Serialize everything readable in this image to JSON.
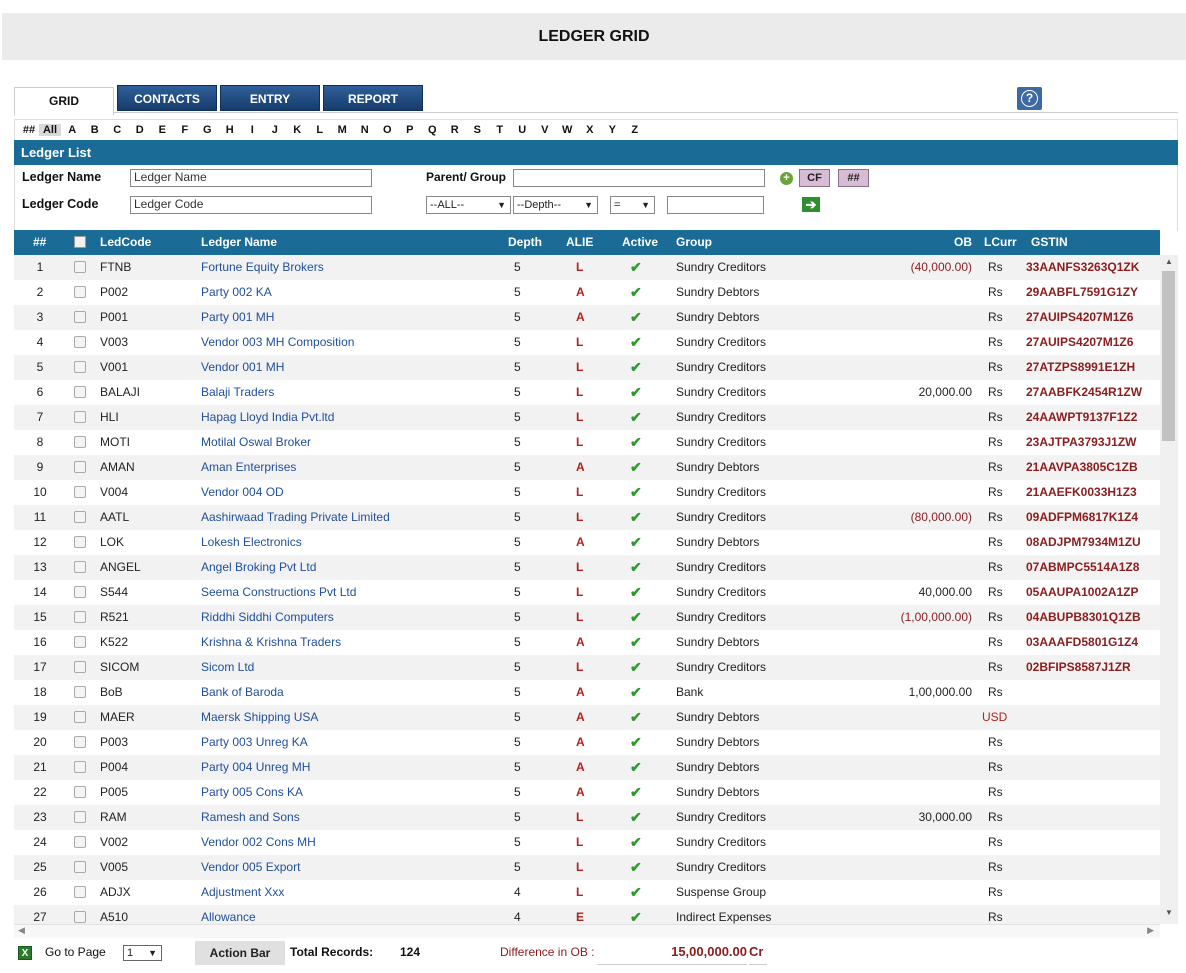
{
  "title": "LEDGER GRID",
  "tabs": [
    "GRID",
    "CONTACTS",
    "ENTRY",
    "REPORT"
  ],
  "alphabet": [
    "##",
    "All",
    "A",
    "B",
    "C",
    "D",
    "E",
    "F",
    "G",
    "H",
    "I",
    "J",
    "K",
    "L",
    "M",
    "N",
    "O",
    "P",
    "Q",
    "R",
    "S",
    "T",
    "U",
    "V",
    "W",
    "X",
    "Y",
    "Z"
  ],
  "selected_letter": "All",
  "list_title": "Ledger List",
  "filters": {
    "ledger_name_label": "Ledger Name",
    "ledger_name_value": "Ledger Name",
    "ledger_code_label": "Ledger Code",
    "ledger_code_value": "Ledger Code",
    "parent_group_label": "Parent/ Group",
    "parent_group_value": "",
    "type_select": "--ALL--",
    "depth_select": "--Depth--",
    "op_select": "=",
    "depth_value": "",
    "cf_label": "CF",
    "hash_label": "##"
  },
  "columns": {
    "num": "##",
    "code": "LedCode",
    "name": "Ledger Name",
    "depth": "Depth",
    "alie": "ALIE",
    "active": "Active",
    "group": "Group",
    "ob": "OB",
    "lcurr": "LCurr",
    "gstin": "GSTIN"
  },
  "rows": [
    {
      "n": "1",
      "code": "FTNB",
      "name": "Fortune Equity Brokers",
      "depth": "5",
      "alie": "L",
      "group": "Sundry Creditors",
      "ob": "(40,000.00)",
      "neg": true,
      "cur": "Rs",
      "gstin": "33AANFS3263Q1ZK"
    },
    {
      "n": "2",
      "code": "P002",
      "name": "Party 002 KA",
      "depth": "5",
      "alie": "A",
      "group": "Sundry Debtors",
      "ob": "",
      "neg": false,
      "cur": "Rs",
      "gstin": "29AABFL7591G1ZY"
    },
    {
      "n": "3",
      "code": "P001",
      "name": "Party 001 MH",
      "depth": "5",
      "alie": "A",
      "group": "Sundry Debtors",
      "ob": "",
      "neg": false,
      "cur": "Rs",
      "gstin": "27AUIPS4207M1Z6"
    },
    {
      "n": "4",
      "code": "V003",
      "name": "Vendor 003 MH Composition",
      "depth": "5",
      "alie": "L",
      "group": "Sundry Creditors",
      "ob": "",
      "neg": false,
      "cur": "Rs",
      "gstin": "27AUIPS4207M1Z6"
    },
    {
      "n": "5",
      "code": "V001",
      "name": "Vendor 001 MH",
      "depth": "5",
      "alie": "L",
      "group": "Sundry Creditors",
      "ob": "",
      "neg": false,
      "cur": "Rs",
      "gstin": "27ATZPS8991E1ZH"
    },
    {
      "n": "6",
      "code": "BALAJI",
      "name": "Balaji Traders",
      "depth": "5",
      "alie": "L",
      "group": "Sundry Creditors",
      "ob": "20,000.00",
      "neg": false,
      "cur": "Rs",
      "gstin": "27AABFK2454R1ZW"
    },
    {
      "n": "7",
      "code": "HLI",
      "name": "Hapag Lloyd India Pvt.ltd",
      "depth": "5",
      "alie": "L",
      "group": "Sundry Creditors",
      "ob": "",
      "neg": false,
      "cur": "Rs",
      "gstin": "24AAWPT9137F1Z2"
    },
    {
      "n": "8",
      "code": "MOTI",
      "name": "Motilal Oswal Broker",
      "depth": "5",
      "alie": "L",
      "group": "Sundry Creditors",
      "ob": "",
      "neg": false,
      "cur": "Rs",
      "gstin": "23AJTPA3793J1ZW"
    },
    {
      "n": "9",
      "code": "AMAN",
      "name": "Aman Enterprises",
      "depth": "5",
      "alie": "A",
      "group": "Sundry Debtors",
      "ob": "",
      "neg": false,
      "cur": "Rs",
      "gstin": "21AAVPA3805C1ZB"
    },
    {
      "n": "10",
      "code": "V004",
      "name": "Vendor 004 OD",
      "depth": "5",
      "alie": "L",
      "group": "Sundry Creditors",
      "ob": "",
      "neg": false,
      "cur": "Rs",
      "gstin": "21AAEFK0033H1Z3"
    },
    {
      "n": "11",
      "code": "AATL",
      "name": "Aashirwaad Trading Private Limited",
      "depth": "5",
      "alie": "L",
      "group": "Sundry Creditors",
      "ob": "(80,000.00)",
      "neg": true,
      "cur": "Rs",
      "gstin": "09ADFPM6817K1Z4"
    },
    {
      "n": "12",
      "code": "LOK",
      "name": "Lokesh Electronics",
      "depth": "5",
      "alie": "A",
      "group": "Sundry Debtors",
      "ob": "",
      "neg": false,
      "cur": "Rs",
      "gstin": "08ADJPM7934M1ZU"
    },
    {
      "n": "13",
      "code": "ANGEL",
      "name": "Angel Broking Pvt Ltd",
      "depth": "5",
      "alie": "L",
      "group": "Sundry Creditors",
      "ob": "",
      "neg": false,
      "cur": "Rs",
      "gstin": "07ABMPC5514A1Z8"
    },
    {
      "n": "14",
      "code": "S544",
      "name": "Seema Constructions Pvt Ltd",
      "depth": "5",
      "alie": "L",
      "group": "Sundry Creditors",
      "ob": "40,000.00",
      "neg": false,
      "cur": "Rs",
      "gstin": "05AAUPA1002A1ZP"
    },
    {
      "n": "15",
      "code": "R521",
      "name": "Riddhi Siddhi Computers",
      "depth": "5",
      "alie": "L",
      "group": "Sundry Creditors",
      "ob": "(1,00,000.00)",
      "neg": true,
      "cur": "Rs",
      "gstin": "04ABUPB8301Q1ZB"
    },
    {
      "n": "16",
      "code": "K522",
      "name": "Krishna & Krishna Traders",
      "depth": "5",
      "alie": "A",
      "group": "Sundry Debtors",
      "ob": "",
      "neg": false,
      "cur": "Rs",
      "gstin": "03AAAFD5801G1Z4"
    },
    {
      "n": "17",
      "code": "SICOM",
      "name": "Sicom Ltd",
      "depth": "5",
      "alie": "L",
      "group": "Sundry Creditors",
      "ob": "",
      "neg": false,
      "cur": "Rs",
      "gstin": "02BFIPS8587J1ZR"
    },
    {
      "n": "18",
      "code": "BoB",
      "name": "Bank of Baroda",
      "depth": "5",
      "alie": "A",
      "group": "Bank",
      "ob": "1,00,000.00",
      "neg": false,
      "cur": "Rs",
      "gstin": ""
    },
    {
      "n": "19",
      "code": "MAER",
      "name": "Maersk Shipping USA",
      "depth": "5",
      "alie": "A",
      "group": "Sundry Debtors",
      "ob": "",
      "neg": false,
      "cur": "USD",
      "gstin": ""
    },
    {
      "n": "20",
      "code": "P003",
      "name": "Party 003 Unreg KA",
      "depth": "5",
      "alie": "A",
      "group": "Sundry Debtors",
      "ob": "",
      "neg": false,
      "cur": "Rs",
      "gstin": ""
    },
    {
      "n": "21",
      "code": "P004",
      "name": "Party 004 Unreg MH",
      "depth": "5",
      "alie": "A",
      "group": "Sundry Debtors",
      "ob": "",
      "neg": false,
      "cur": "Rs",
      "gstin": ""
    },
    {
      "n": "22",
      "code": "P005",
      "name": "Party 005 Cons KA",
      "depth": "5",
      "alie": "A",
      "group": "Sundry Debtors",
      "ob": "",
      "neg": false,
      "cur": "Rs",
      "gstin": ""
    },
    {
      "n": "23",
      "code": "RAM",
      "name": "Ramesh and Sons",
      "depth": "5",
      "alie": "L",
      "group": "Sundry Creditors",
      "ob": "30,000.00",
      "neg": false,
      "cur": "Rs",
      "gstin": ""
    },
    {
      "n": "24",
      "code": "V002",
      "name": "Vendor 002 Cons MH",
      "depth": "5",
      "alie": "L",
      "group": "Sundry Creditors",
      "ob": "",
      "neg": false,
      "cur": "Rs",
      "gstin": ""
    },
    {
      "n": "25",
      "code": "V005",
      "name": "Vendor 005 Export",
      "depth": "5",
      "alie": "L",
      "group": "Sundry Creditors",
      "ob": "",
      "neg": false,
      "cur": "Rs",
      "gstin": ""
    },
    {
      "n": "26",
      "code": "ADJX",
      "name": "Adjustment Xxx",
      "depth": "4",
      "alie": "L",
      "group": "Suspense Group",
      "ob": "",
      "neg": false,
      "cur": "Rs",
      "gstin": ""
    },
    {
      "n": "27",
      "code": "A510",
      "name": "Allowance",
      "depth": "4",
      "alie": "E",
      "group": "Indirect Expenses",
      "ob": "",
      "neg": false,
      "cur": "Rs",
      "gstin": ""
    }
  ],
  "footer": {
    "goto_label": "Go to Page",
    "page_value": "1",
    "action_bar_label": "Action Bar",
    "total_label": "Total Records:",
    "total_value": "124",
    "diff_label": "Difference in OB :",
    "diff_value": "15,00,000.00",
    "diff_suffix": "Cr"
  },
  "colors": {
    "header_blue": "#1a6c96",
    "tab_blue": "#1f4d80",
    "link_blue": "#1f4f9a",
    "alie_red": "#b22020",
    "gstin_maroon": "#8a1d1d",
    "check_green": "#2e9a2e"
  },
  "icons": {
    "help": "question-circle-icon",
    "add": "plus-circle-icon",
    "go": "arrow-right-icon",
    "active": "check-icon",
    "export": "excel-icon"
  }
}
